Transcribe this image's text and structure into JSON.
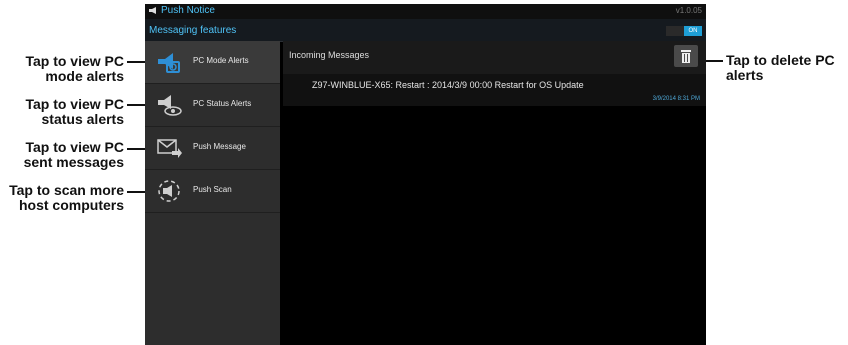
{
  "app": {
    "title": "Push Notice",
    "version": "v1.0.05",
    "section_title": "Messaging features",
    "toggle_label": "ON"
  },
  "sidebar": {
    "items": [
      {
        "label": "PC Mode Alerts",
        "icon": "pc-mode-alerts-icon"
      },
      {
        "label": "PC Status Alerts",
        "icon": "pc-status-alerts-icon"
      },
      {
        "label": "Push Message",
        "icon": "push-message-icon"
      },
      {
        "label": "Push Scan",
        "icon": "push-scan-icon"
      }
    ]
  },
  "main": {
    "header": "Incoming Messages",
    "messages": [
      {
        "text": "Z97-WINBLUE-X65: Restart : 2014/3/9 00:00 Restart for OS Update",
        "time": "3/9/2014  8:31 PM"
      }
    ]
  },
  "callouts": {
    "pc_mode": "Tap to view PC mode alerts",
    "pc_status": "Tap to view PC status alerts",
    "sent": "Tap to view PC sent messages",
    "scan": "Tap to scan more host computers",
    "delete": "Tap to  delete PC alerts"
  },
  "colors": {
    "accent": "#4fc3f7",
    "toggle_on": "#1e9fd6",
    "sidebar": "#2d2d2d"
  }
}
